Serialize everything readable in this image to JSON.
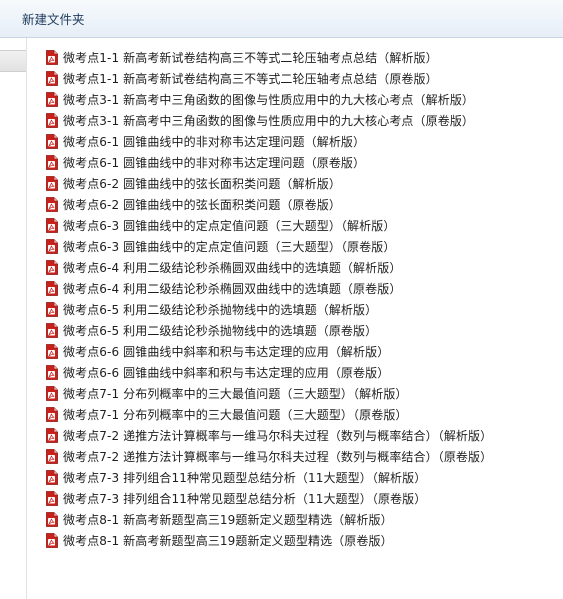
{
  "toolbar": {
    "new_folder_label": "新建文件夹"
  },
  "icon": "pdf-icon",
  "files": [
    "微考点1-1 新高考新试卷结构高三不等式二轮压轴考点总结（解析版）",
    "微考点1-1 新高考新试卷结构高三不等式二轮压轴考点总结（原卷版）",
    "微考点3-1 新高考中三角函数的图像与性质应用中的九大核心考点（解析版）",
    "微考点3-1 新高考中三角函数的图像与性质应用中的九大核心考点（原卷版）",
    "微考点6-1 圆锥曲线中的非对称韦达定理问题（解析版）",
    "微考点6-1 圆锥曲线中的非对称韦达定理问题（原卷版）",
    "微考点6-2 圆锥曲线中的弦长面积类问题（解析版）",
    "微考点6-2 圆锥曲线中的弦长面积类问题（原卷版）",
    "微考点6-3 圆锥曲线中的定点定值问题（三大题型）（解析版）",
    "微考点6-3 圆锥曲线中的定点定值问题（三大题型）（原卷版）",
    "微考点6-4 利用二级结论秒杀椭圆双曲线中的选填题（解析版）",
    "微考点6-4 利用二级结论秒杀椭圆双曲线中的选填题（原卷版）",
    "微考点6-5 利用二级结论秒杀抛物线中的选填题（解析版）",
    "微考点6-5 利用二级结论秒杀抛物线中的选填题（原卷版）",
    "微考点6-6 圆锥曲线中斜率和积与韦达定理的应用（解析版）",
    "微考点6-6 圆锥曲线中斜率和积与韦达定理的应用（原卷版）",
    "微考点7-1 分布列概率中的三大最值问题（三大题型）（解析版）",
    "微考点7-1 分布列概率中的三大最值问题（三大题型）（原卷版）",
    "微考点7-2 递推方法计算概率与一维马尔科夫过程（数列与概率结合）（解析版）",
    "微考点7-2 递推方法计算概率与一维马尔科夫过程（数列与概率结合）（原卷版）",
    "微考点7-3 排列组合11种常见题型总结分析（11大题型）（解析版）",
    "微考点7-3 排列组合11种常见题型总结分析（11大题型）（原卷版）",
    "微考点8-1 新高考新题型高三19题新定义题型精选（解析版）",
    "微考点8-1 新高考新题型高三19题新定义题型精选（原卷版）"
  ]
}
